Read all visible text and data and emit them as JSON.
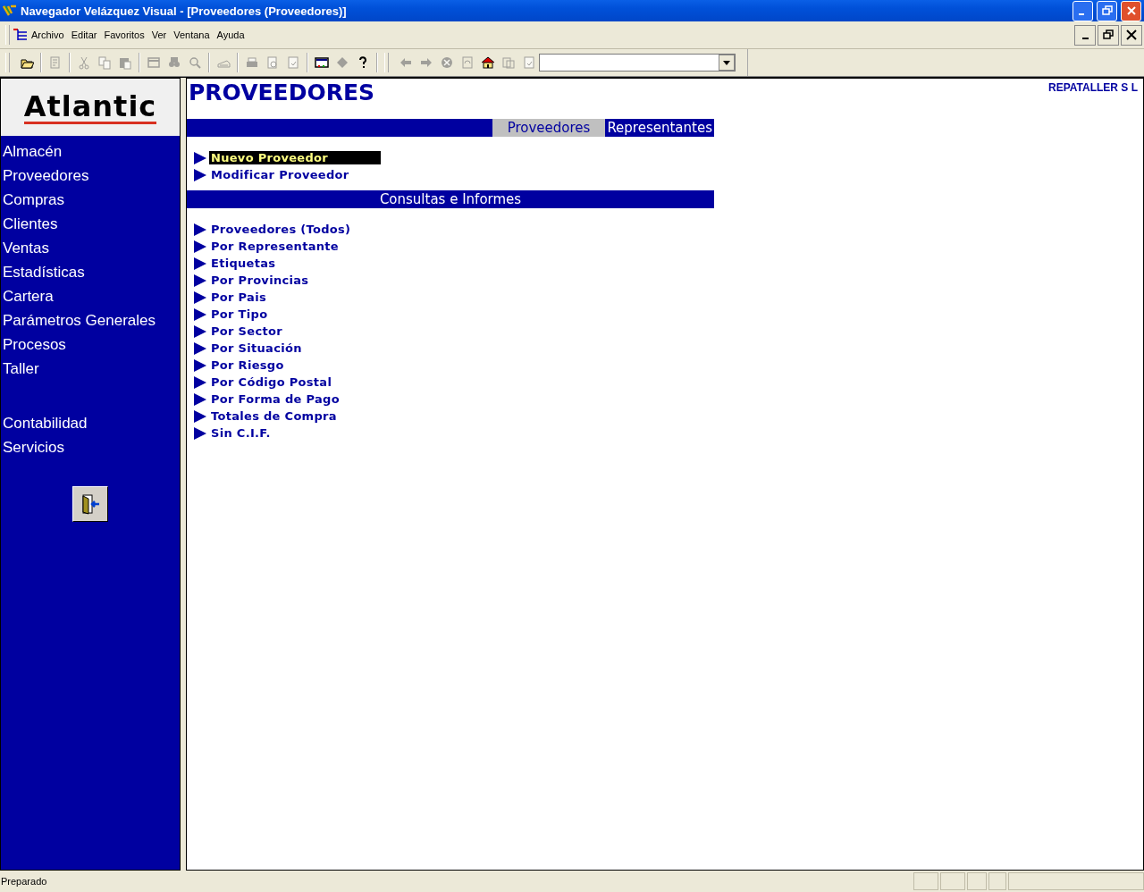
{
  "window": {
    "title": "Navegador Velázquez Visual - [Proveedores (Proveedores)]"
  },
  "menu_bar": [
    "Archivo",
    "Editar",
    "Favoritos",
    "Ver",
    "Ventana",
    "Ayuda"
  ],
  "toolbar": [
    {
      "kind": "open",
      "disabled": false
    },
    {
      "kind": "sep"
    },
    {
      "kind": "edit",
      "disabled": true
    },
    {
      "kind": "sep"
    },
    {
      "kind": "cut",
      "disabled": true
    },
    {
      "kind": "copy",
      "disabled": true
    },
    {
      "kind": "paste",
      "disabled": true
    },
    {
      "kind": "sep"
    },
    {
      "kind": "window",
      "disabled": true
    },
    {
      "kind": "binoculars",
      "disabled": true
    },
    {
      "kind": "search",
      "disabled": true
    },
    {
      "kind": "sep"
    },
    {
      "kind": "scanner",
      "disabled": true
    },
    {
      "kind": "sep"
    },
    {
      "kind": "print",
      "disabled": true
    },
    {
      "kind": "preview",
      "disabled": true
    },
    {
      "kind": "page",
      "disabled": true
    },
    {
      "kind": "sep"
    },
    {
      "kind": "monitor",
      "disabled": false
    },
    {
      "kind": "tag",
      "disabled": true
    },
    {
      "kind": "help",
      "disabled": false
    },
    {
      "kind": "grip"
    },
    {
      "kind": "back",
      "disabled": true
    },
    {
      "kind": "forward",
      "disabled": true
    },
    {
      "kind": "stop",
      "disabled": true
    },
    {
      "kind": "refresh",
      "disabled": true
    },
    {
      "kind": "home",
      "disabled": false
    },
    {
      "kind": "history",
      "disabled": true
    },
    {
      "kind": "page",
      "disabled": true
    }
  ],
  "sidebar": {
    "logo": "Atlantic",
    "items": [
      "Almacén",
      "Proveedores",
      "Compras",
      "Clientes",
      "Ventas",
      "Estadísticas",
      "Cartera",
      "Parámetros Generales",
      "Procesos",
      "Taller"
    ],
    "items_2": [
      "Contabilidad",
      "Servicios"
    ]
  },
  "page": {
    "title": "PROVEEDORES",
    "company": "REPATALLER S L",
    "tabs": [
      {
        "label": "Proveedores",
        "selected": true
      },
      {
        "label": "Representantes",
        "selected": false
      }
    ],
    "actions": [
      {
        "label": "Nuevo Proveedor",
        "selected": true
      },
      {
        "label": "Modificar Proveedor",
        "selected": false
      }
    ],
    "reports_heading": "Consultas e Informes",
    "reports": [
      "Proveedores (Todos)",
      "Por  Representante",
      "Etiquetas",
      "Por Provincias",
      "Por Pais",
      "Por Tipo",
      "Por Sector",
      "Por Situación",
      "Por Riesgo",
      "Por Código Postal",
      "Por Forma de Pago",
      "Totales de Compra",
      "Sin C.I.F."
    ]
  },
  "status_bar": {
    "text": "Preparado"
  }
}
